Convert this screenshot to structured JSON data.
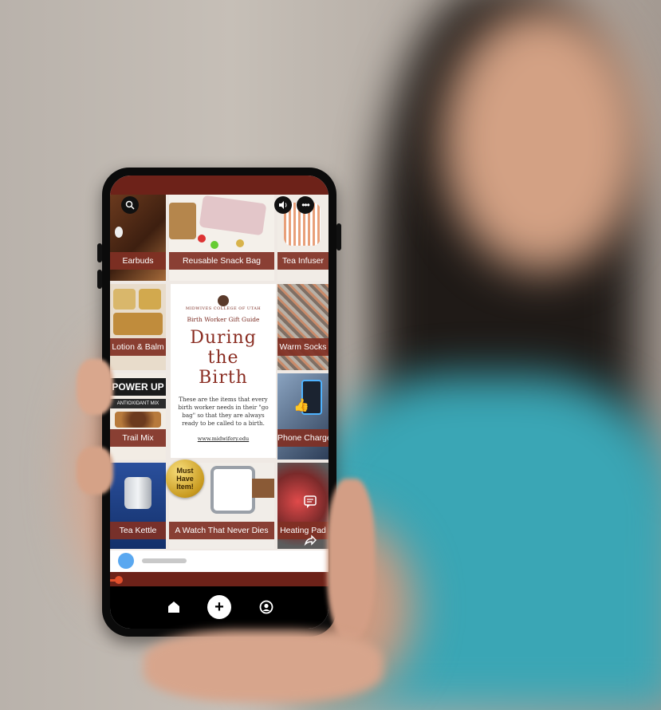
{
  "pin_tiles": {
    "earbuds": "Earbuds",
    "snack_bag": "Reusable Snack Bag",
    "tea_infuser": "Tea Infuser",
    "lotion": "Lotion & Balm",
    "socks": "Warm Socks",
    "trail_mix": "Trail Mix",
    "phone_charger": "Phone Charger",
    "kettle": "Tea Kettle",
    "watch": "A Watch That Never Dies",
    "heating_pad": "Heating Pad"
  },
  "product_text": {
    "power_up": "POWER UP",
    "antioxidant": "ANTIOXIDANT MIX"
  },
  "center_card": {
    "logo_text": "MIDWIVES COLLEGE OF UTAH",
    "guide_title": "Birth Worker Gift Guide",
    "title_line1": "During",
    "title_line2": "the",
    "title_line3": "Birth",
    "description": "These are the items that every birth worker needs in their \"go bag\" so that they are always ready to be called to a birth.",
    "url": "www.midwifery.edu"
  },
  "badge": {
    "line1": "Must",
    "line2": "Have",
    "line3": "Item!"
  },
  "icons": {
    "search": "search-icon",
    "volume": "volume-icon",
    "more": "more-icon",
    "comment": "comment-icon",
    "share": "share-icon",
    "home": "home-icon",
    "add": "add-icon",
    "profile": "profile-icon"
  },
  "progress": {
    "value": 0.04
  },
  "colors": {
    "brand": "#6d2219",
    "label_bg": "#803024",
    "progress": "#e2502c"
  }
}
